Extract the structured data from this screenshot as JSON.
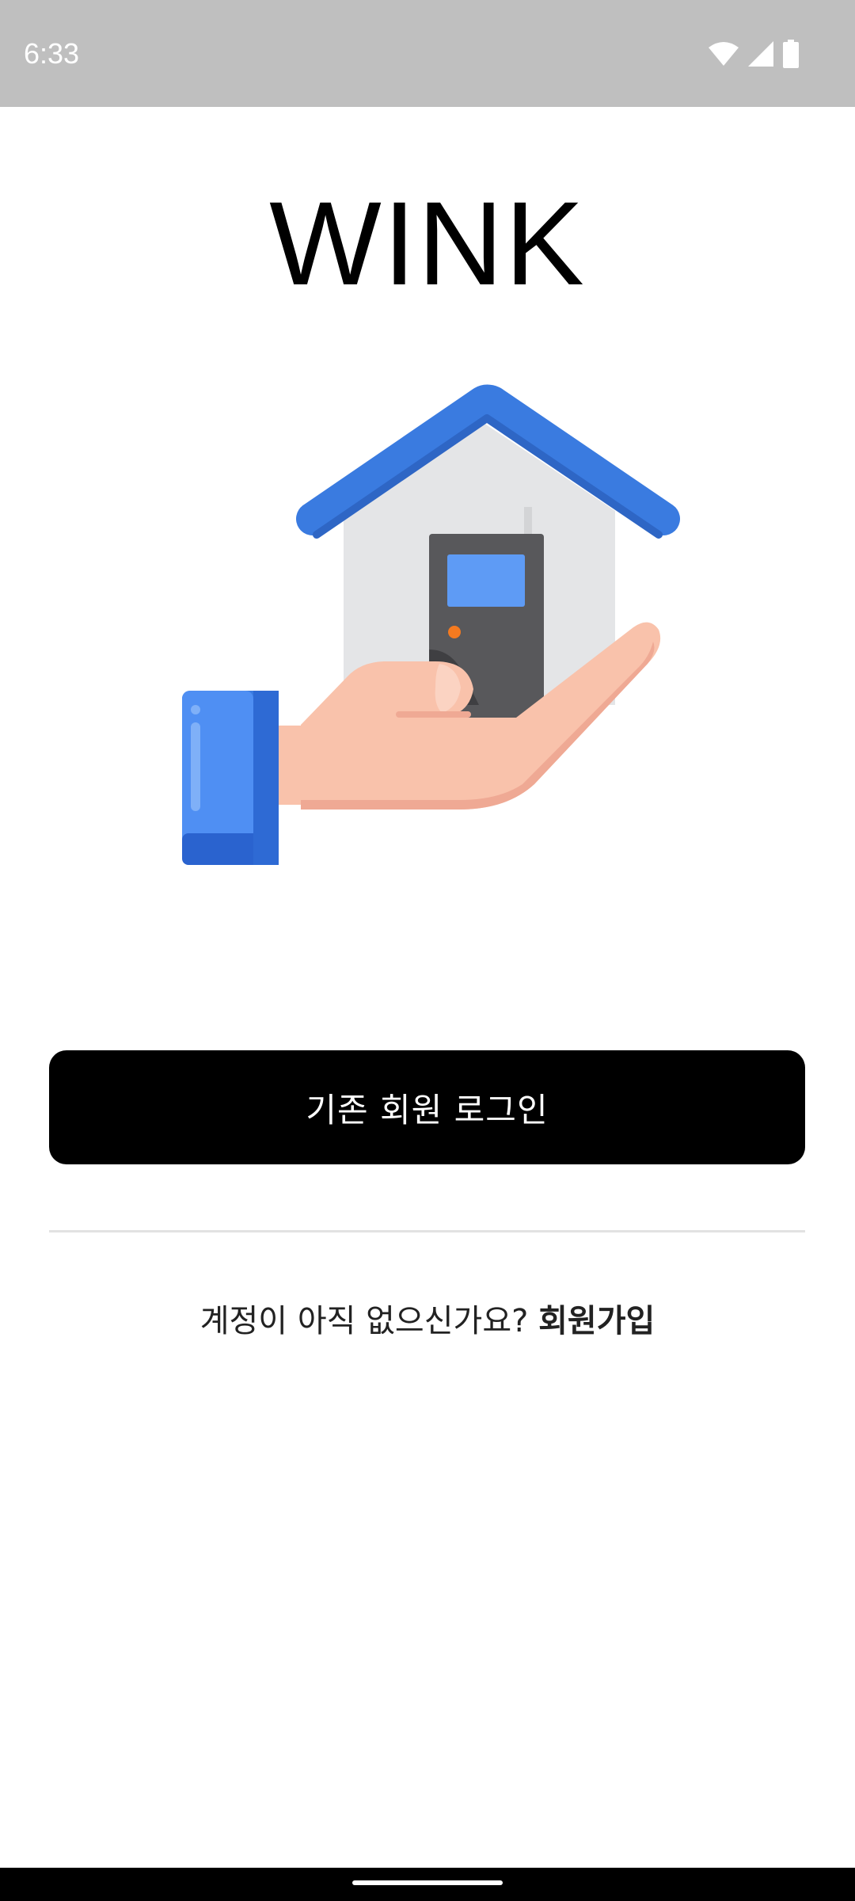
{
  "status_bar": {
    "time": "6:33",
    "icons": [
      "wifi-icon",
      "cellular-signal-icon",
      "battery-icon"
    ]
  },
  "app": {
    "title": "WINK"
  },
  "hero": {
    "icon": "house-in-hand-icon"
  },
  "actions": {
    "login_label": "기존 회원 로그인",
    "signup_prompt": "계정이 아직 없으신가요?",
    "signup_link": "회원가입"
  },
  "colors": {
    "status_bar_bg": "#bfbfbf",
    "primary_button_bg": "#000000",
    "primary_button_text": "#ffffff",
    "roof_blue": "#3a7be0",
    "door_screen_blue": "#5e9bf5",
    "skin": "#f9c2ab",
    "door_dark": "#58585b",
    "door_button_orange": "#f47a20"
  }
}
